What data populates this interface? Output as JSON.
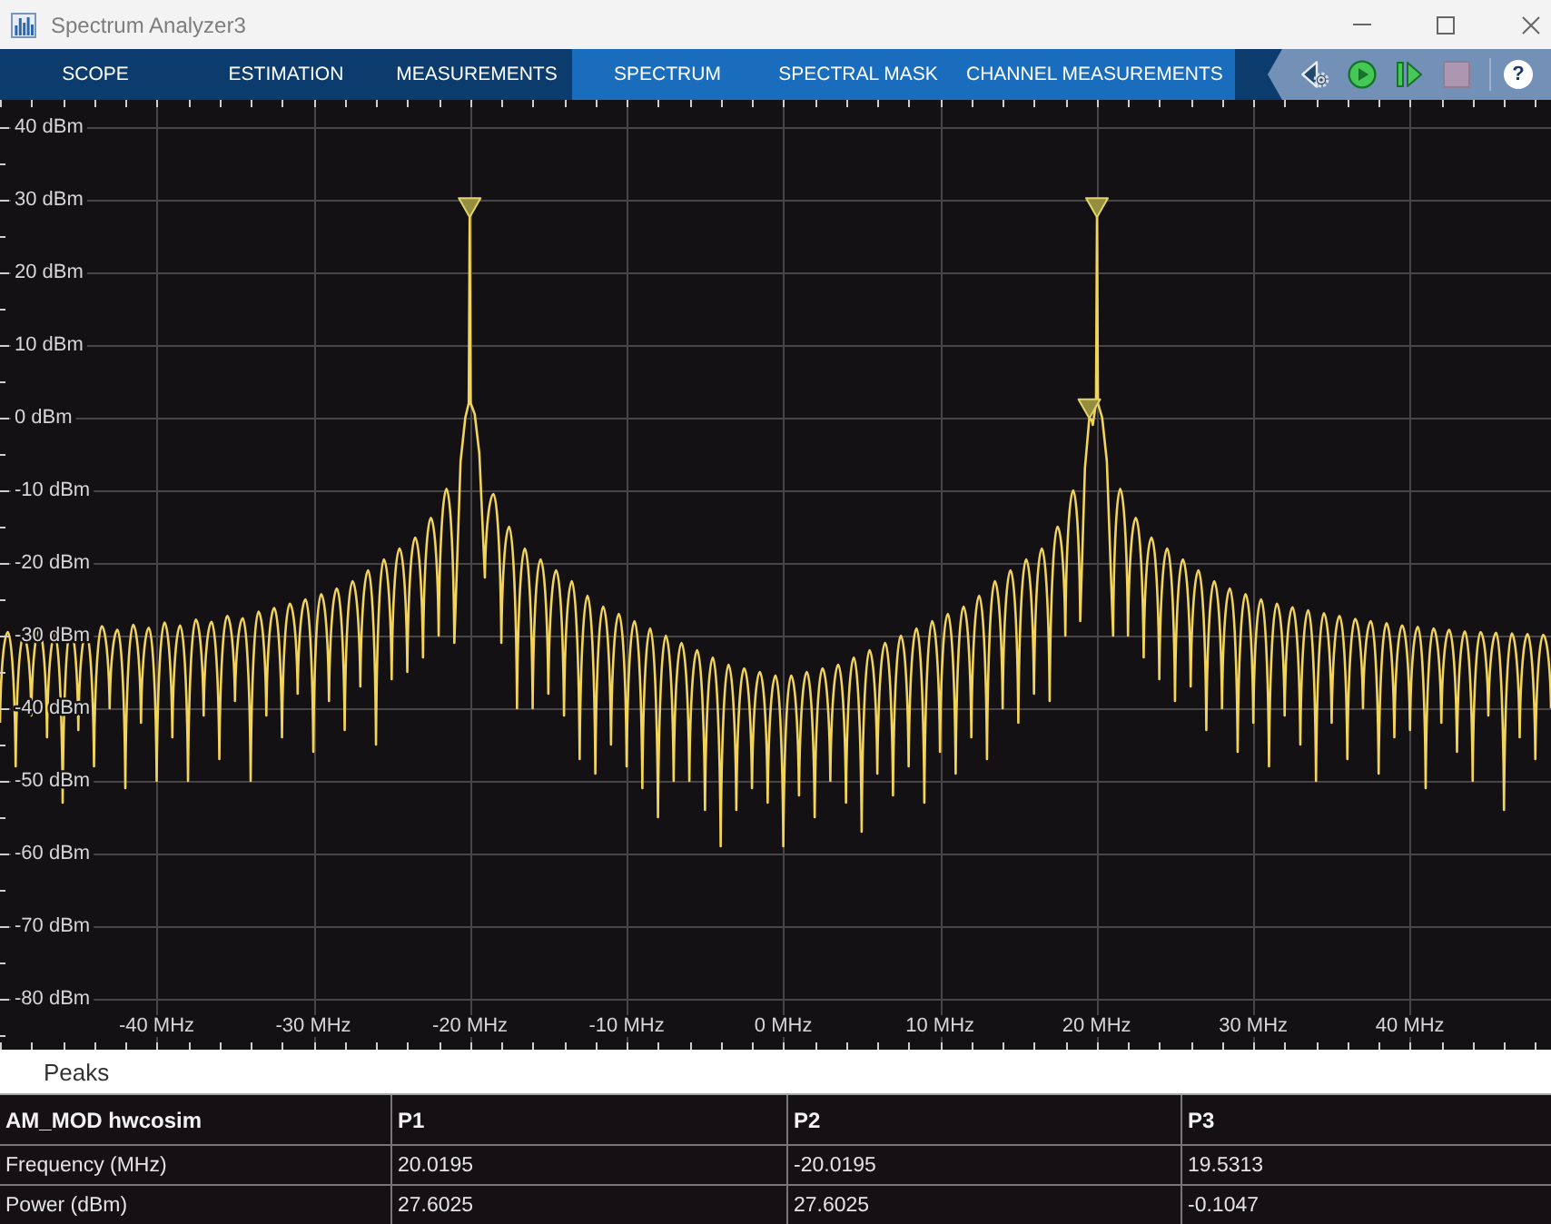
{
  "window": {
    "title": "Spectrum Analyzer3"
  },
  "tabs": [
    {
      "label": "SCOPE",
      "kind": "common",
      "selected": false
    },
    {
      "label": "ESTIMATION",
      "kind": "common",
      "selected": false
    },
    {
      "label": "MEASUREMENTS",
      "kind": "common",
      "selected": false
    },
    {
      "label": "SPECTRUM",
      "kind": "contextual",
      "selected": false
    },
    {
      "label": "SPECTRAL MASK",
      "kind": "contextual",
      "selected": false
    },
    {
      "label": "CHANNEL MEASUREMENTS",
      "kind": "contextual",
      "selected": false
    }
  ],
  "toolbar": [
    {
      "kind": "settings",
      "disabled": false
    },
    {
      "kind": "run",
      "disabled": false
    },
    {
      "kind": "step",
      "disabled": false
    },
    {
      "kind": "stop",
      "disabled": true
    },
    {
      "kind": "help",
      "label": "?",
      "disabled": false
    }
  ],
  "plot": {
    "chart_data": {
      "type": "line",
      "grid": true,
      "xlim": [
        -50,
        49
      ],
      "ylim": [
        -87,
        43.75
      ],
      "xticks": [
        {
          "value": -40,
          "label": "-40 MHz"
        },
        {
          "value": -30,
          "label": "-30 MHz"
        },
        {
          "value": -20,
          "label": "-20 MHz"
        },
        {
          "value": -10,
          "label": "-10 MHz"
        },
        {
          "value": 0,
          "label": "0 MHz"
        },
        {
          "value": 10,
          "label": "10 MHz"
        },
        {
          "value": 20,
          "label": "20 MHz"
        },
        {
          "value": 30,
          "label": "30 MHz"
        },
        {
          "value": 40,
          "label": "40 MHz"
        }
      ],
      "yticks": [
        {
          "value": 40,
          "label": "40 dBm"
        },
        {
          "value": 30,
          "label": "30 dBm"
        },
        {
          "value": 20,
          "label": "20 dBm"
        },
        {
          "value": 10,
          "label": "10 dBm"
        },
        {
          "value": 0,
          "label": "0 dBm"
        },
        {
          "value": -10,
          "label": "-10 dBm"
        },
        {
          "value": -20,
          "label": "-20 dBm"
        },
        {
          "value": -30,
          "label": "-30 dBm"
        },
        {
          "value": -40,
          "label": "-40 dBm"
        },
        {
          "value": -50,
          "label": "-50 dBm"
        },
        {
          "value": -60,
          "label": "-60 dBm"
        },
        {
          "value": -70,
          "label": "-70 dBm"
        },
        {
          "value": -80,
          "label": "-80 dBm"
        }
      ],
      "x": [
        -50,
        -49.5,
        -49,
        -48.5,
        -48,
        -47.5,
        -47,
        -46.5,
        -46,
        -45.5,
        -45,
        -44.5,
        -44,
        -43.5,
        -43,
        -42.5,
        -42,
        -41.5,
        -41,
        -40.5,
        -40,
        -39.5,
        -39,
        -38.5,
        -38,
        -37.5,
        -37,
        -36.5,
        -36,
        -35.5,
        -35,
        -34.5,
        -34,
        -33.5,
        -33,
        -32.5,
        -32,
        -31.5,
        -31,
        -30.5,
        -30,
        -29.5,
        -29,
        -28.5,
        -28,
        -27.5,
        -27,
        -26.5,
        -26,
        -25.5,
        -25,
        -24.5,
        -24,
        -23.5,
        -23,
        -22.5,
        -22,
        -21.5,
        -21,
        -20.6,
        -20.3,
        -20.08,
        -20.02,
        -19.96,
        -19.7,
        -19.4,
        -19.05,
        -18.5,
        -18,
        -17.5,
        -17,
        -16.5,
        -16,
        -15.5,
        -15,
        -14.5,
        -14,
        -13.5,
        -13,
        -12.5,
        -12,
        -11.5,
        -11,
        -10.5,
        -10,
        -9.5,
        -9,
        -8.5,
        -8,
        -7.5,
        -7,
        -6.5,
        -6,
        -5.5,
        -5,
        -4.5,
        -4,
        -3.5,
        -3,
        -2.5,
        -2,
        -1.5,
        -1,
        -0.5,
        0,
        0.5,
        1,
        1.5,
        2,
        2.5,
        3,
        3.5,
        4,
        4.5,
        5,
        5.5,
        6,
        6.5,
        7,
        7.5,
        8,
        8.5,
        9,
        9.5,
        10,
        10.5,
        11,
        11.5,
        12,
        12.5,
        13,
        13.5,
        14,
        14.5,
        15,
        15.5,
        16,
        16.5,
        17,
        17.5,
        18,
        18.5,
        18.95,
        19.25,
        19.53,
        19.75,
        19.96,
        20.02,
        20.08,
        20.35,
        20.65,
        21.05,
        21.5,
        22,
        22.5,
        23,
        23.5,
        24,
        24.5,
        25,
        25.5,
        26,
        26.5,
        27,
        27.5,
        28,
        28.5,
        29,
        29.5,
        30,
        30.5,
        31,
        31.5,
        32,
        32.5,
        33,
        33.5,
        34,
        34.5,
        35,
        35.5,
        36,
        36.5,
        37,
        37.5,
        38,
        38.5,
        39,
        39.5,
        40,
        40.5,
        41,
        41.5,
        42,
        42.5,
        43,
        43.5,
        44,
        44.5,
        45,
        45.5,
        46,
        46.5,
        47,
        47.5,
        48,
        48.5,
        49
      ],
      "series": [
        {
          "color": "#f2d35b",
          "values": [
            -42,
            -29.5,
            -48,
            -30,
            -41,
            -29.2,
            -44,
            -29.8,
            -53,
            -29,
            -43,
            -29.5,
            -48,
            -28.7,
            -40,
            -29.2,
            -51,
            -28.5,
            -42,
            -28.9,
            -50,
            -28.2,
            -44,
            -28.6,
            -50,
            -27.8,
            -41,
            -28.1,
            -47,
            -27.3,
            -39,
            -27.6,
            -50,
            -26.7,
            -41,
            -26.2,
            -44,
            -25.6,
            -38,
            -25,
            -46,
            -24.3,
            -39,
            -23.5,
            -43,
            -22.5,
            -37,
            -21,
            -45,
            -19.5,
            -36,
            -18,
            -35,
            -16.5,
            -33,
            -13.8,
            -30,
            -9.8,
            -31,
            -6,
            0,
            2,
            27.6,
            2,
            0.5,
            -5,
            -22,
            -10.5,
            -31,
            -15,
            -40,
            -18,
            -40,
            -19.5,
            -38,
            -21,
            -41,
            -22.5,
            -47,
            -24.5,
            -49,
            -26,
            -45,
            -27,
            -48,
            -28,
            -51,
            -29,
            -55,
            -30,
            -50,
            -31,
            -50,
            -32,
            -54,
            -33,
            -59,
            -34,
            -54,
            -34.5,
            -51,
            -35,
            -53,
            -35.5,
            -59,
            -35.5,
            -52,
            -35,
            -55,
            -34.5,
            -50,
            -34,
            -53,
            -33,
            -57,
            -32,
            -49,
            -31,
            -52,
            -30,
            -48,
            -29,
            -53,
            -28,
            -46,
            -27,
            -49,
            -26,
            -44,
            -24.5,
            -47,
            -22.5,
            -40,
            -21,
            -42,
            -19.5,
            -38,
            -18,
            -39,
            -15,
            -30,
            -10,
            -28,
            -7,
            -0.1,
            -1,
            2,
            27.6,
            2,
            0,
            -6,
            -30,
            -9.8,
            -30,
            -13.8,
            -33,
            -16.5,
            -36,
            -18,
            -39,
            -19.5,
            -37,
            -21,
            -43,
            -22.5,
            -40,
            -23.5,
            -46,
            -24.3,
            -42,
            -25,
            -48,
            -25.6,
            -41,
            -26.1,
            -45,
            -26.5,
            -50,
            -26.9,
            -42,
            -27.3,
            -47,
            -27.7,
            -40,
            -28,
            -49,
            -28.3,
            -44,
            -28.6,
            -43,
            -28.8,
            -51,
            -29,
            -42,
            -29.2,
            -46,
            -29.4,
            -50,
            -29.5,
            -41,
            -29.6,
            -54,
            -29.7,
            -44,
            -29.8,
            -47,
            -29.9,
            -40
          ]
        }
      ]
    }
  },
  "peaks": {
    "title": "Peaks",
    "columns": [
      "AM_MOD hwcosim",
      "P1",
      "P2",
      "P3"
    ],
    "rows": [
      [
        "Frequency (MHz)",
        "20.0195",
        "-20.0195",
        "19.5313"
      ],
      [
        "Power (dBm)",
        "27.6025",
        "27.6025",
        "-0.1047"
      ]
    ]
  }
}
